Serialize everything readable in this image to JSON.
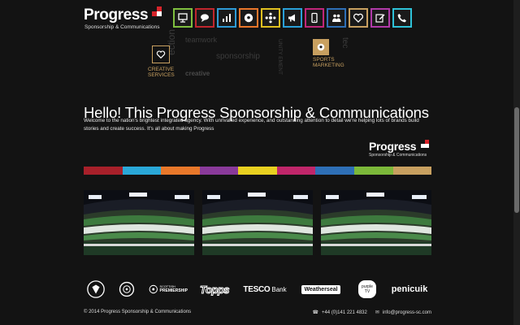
{
  "header": {
    "logo_word": "Progress",
    "logo_sub": "Sponsorship & Communications",
    "nav": [
      {
        "icon": "presentation-icon",
        "color": "#7fbf3f"
      },
      {
        "icon": "speech-bubble-icon",
        "color": "#c0262d"
      },
      {
        "icon": "bar-chart-icon",
        "color": "#2e9bd6"
      },
      {
        "icon": "football-icon",
        "color": "#e9762b"
      },
      {
        "icon": "network-icon",
        "color": "#e0c020"
      },
      {
        "icon": "megaphone-icon",
        "color": "#2aa0d8"
      },
      {
        "icon": "mobile-icon",
        "color": "#c0267a"
      },
      {
        "icon": "people-icon",
        "color": "#2e6fb6"
      },
      {
        "icon": "heart-icon",
        "color": "#c8a060"
      },
      {
        "icon": "edit-icon",
        "color": "#b03aa8"
      },
      {
        "icon": "phone-icon",
        "color": "#2ec2d8"
      }
    ]
  },
  "hero": {
    "words": [
      "teamwork",
      "ection",
      "sponsorship",
      "UNITY EMENT",
      "creative",
      "tec"
    ],
    "creative_label_1": "CREATIVE",
    "creative_label_2": "SERVICES",
    "sports_label_1": "SPORTS",
    "sports_label_2": "MARKETING"
  },
  "main": {
    "headline": "Hello! This Progress Sponsorship & Communications",
    "intro": "Welcome to the nation's brightest integrated agency. With unrivalled experience, and outstanding attention to detail we're helping lots of brands build stories and create success. It's all about making Progress"
  },
  "colorbar": [
    "#a8202a",
    "#2aa8d8",
    "#e8782a",
    "#8a3a9a",
    "#e8d020",
    "#c0266a",
    "#2e6fb6",
    "#7cb83a",
    "#c8a060"
  ],
  "partners": {
    "badge_1": "crest-icon",
    "badge_2": "uefa-icon",
    "spfl_top": "SCOTTISH",
    "spfl": "PREMIERSHIP",
    "topps": "Topps",
    "tesco": "TESCO",
    "tesco_bank": "Bank",
    "weatherseal": "Weatherseal",
    "purple_1": "purple",
    "purple_2": "TV",
    "penicuik": "penicuik"
  },
  "footer": {
    "copyright": "© 2014 Progress Sponsorship & Communications",
    "phone": "+44 (0)141 221 4832",
    "email": "info@progress-sc.com"
  }
}
